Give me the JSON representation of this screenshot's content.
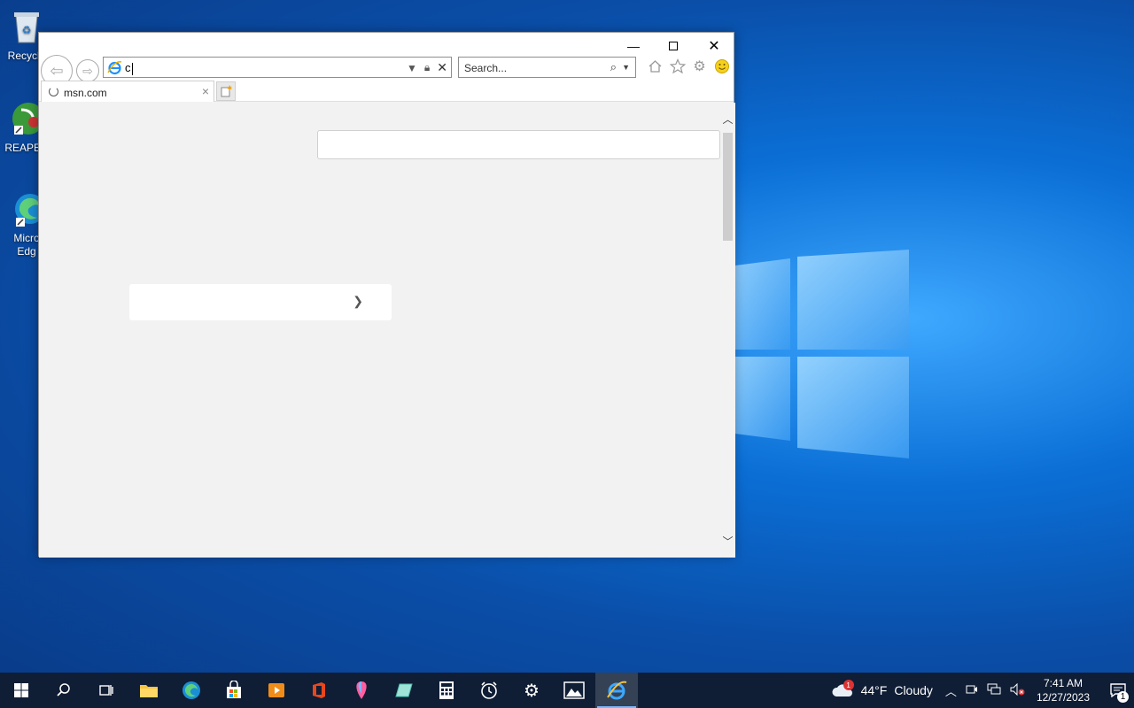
{
  "desktop": {
    "icons": [
      {
        "label": "Recycle"
      },
      {
        "label": "REAPER"
      },
      {
        "label_line1": "Micro",
        "label_line2": "Edg"
      }
    ]
  },
  "browser": {
    "address_value": "c",
    "search_placeholder": "Search...",
    "tab_title": "msn.com",
    "accent": "#1e90ff"
  },
  "taskbar": {
    "weather_temp": "44°F",
    "weather_desc": "Cloudy",
    "weather_badge": "1",
    "time": "7:41 AM",
    "date": "12/27/2023",
    "notification_count": "1"
  }
}
